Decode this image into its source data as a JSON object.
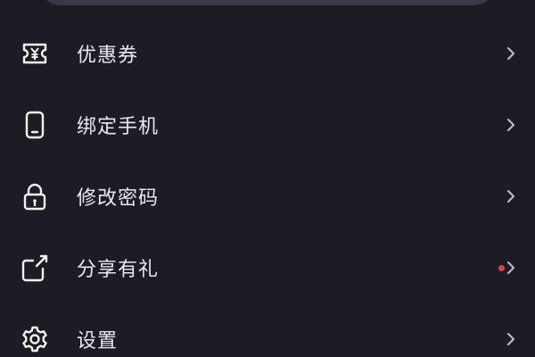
{
  "theme": {
    "background": "#1c1c24",
    "text": "#e9e9ee",
    "icon": "#f2f2f5",
    "chevron": "#b9b9c2",
    "badge": "#e0404a"
  },
  "menu": {
    "items": [
      {
        "label": "优惠券",
        "icon": "coupon-icon",
        "has_badge": false
      },
      {
        "label": "绑定手机",
        "icon": "phone-icon",
        "has_badge": false
      },
      {
        "label": "修改密码",
        "icon": "lock-icon",
        "has_badge": false
      },
      {
        "label": "分享有礼",
        "icon": "share-icon",
        "has_badge": true
      },
      {
        "label": "设置",
        "icon": "gear-icon",
        "has_badge": false
      }
    ]
  }
}
